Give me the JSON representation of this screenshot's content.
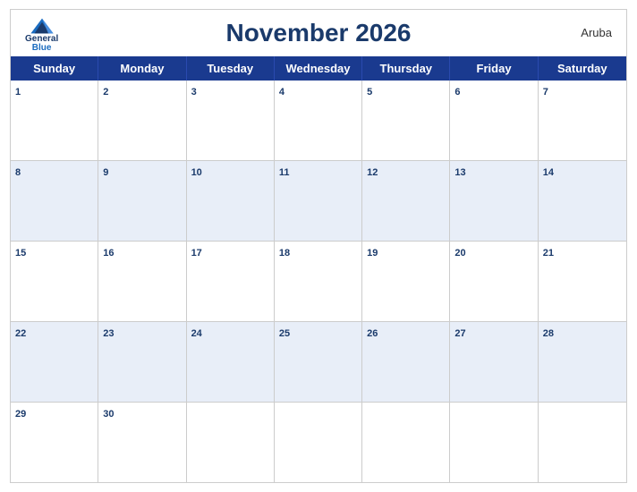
{
  "header": {
    "title": "November 2026",
    "region": "Aruba",
    "logo": {
      "general": "General",
      "blue": "Blue"
    }
  },
  "days": [
    "Sunday",
    "Monday",
    "Tuesday",
    "Wednesday",
    "Thursday",
    "Friday",
    "Saturday"
  ],
  "weeks": [
    [
      1,
      2,
      3,
      4,
      5,
      6,
      7
    ],
    [
      8,
      9,
      10,
      11,
      12,
      13,
      14
    ],
    [
      15,
      16,
      17,
      18,
      19,
      20,
      21
    ],
    [
      22,
      23,
      24,
      25,
      26,
      27,
      28
    ],
    [
      29,
      30,
      null,
      null,
      null,
      null,
      null
    ]
  ],
  "colors": {
    "header_bg": "#1a3a8f",
    "title_color": "#1a3a6b",
    "row_even_bg": "#e8eef8"
  }
}
